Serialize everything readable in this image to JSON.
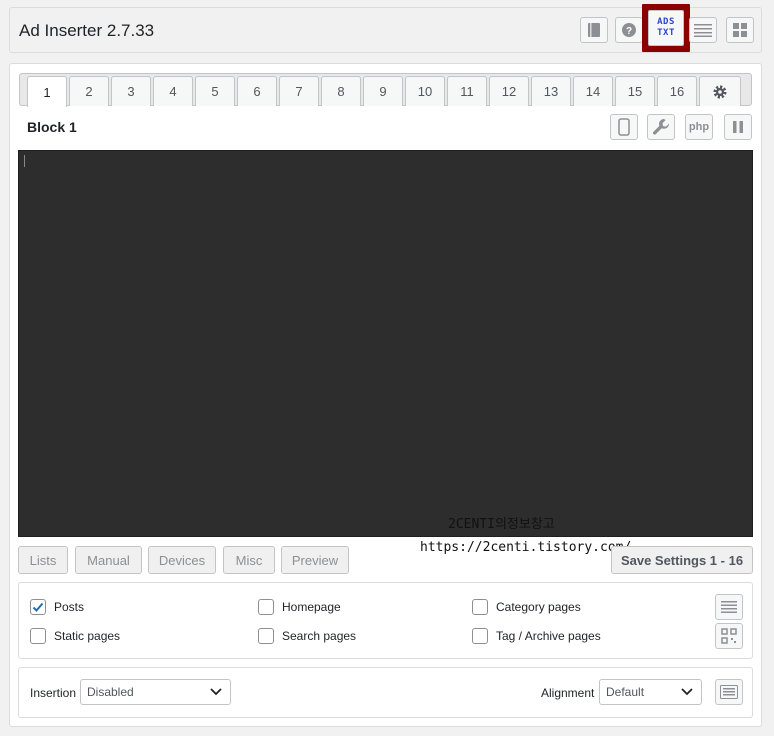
{
  "app": {
    "title": "Ad Inserter 2.7.33"
  },
  "header_icons": [
    "book-icon",
    "help-icon",
    "ads-txt-icon",
    "list-icon",
    "grid-icon"
  ],
  "ads_txt": {
    "line1": "ADS",
    "line2": "TXT"
  },
  "tabs": [
    "1",
    "2",
    "3",
    "4",
    "5",
    "6",
    "7",
    "8",
    "9",
    "10",
    "11",
    "12",
    "13",
    "14",
    "15",
    "16"
  ],
  "active_tab": "1",
  "block": {
    "title": "Block 1",
    "php_label": "php"
  },
  "buttons": {
    "lists": "Lists",
    "manual": "Manual",
    "devices": "Devices",
    "misc": "Misc",
    "preview": "Preview",
    "save": "Save Settings 1 - 16"
  },
  "watermark": {
    "line1": "2CENTI의정보창고",
    "line2": "https://2centi.tistory.com/"
  },
  "checkboxes": {
    "posts": {
      "label": "Posts",
      "checked": true
    },
    "homepage": {
      "label": "Homepage",
      "checked": false
    },
    "category": {
      "label": "Category pages",
      "checked": false
    },
    "static": {
      "label": "Static pages",
      "checked": false
    },
    "search": {
      "label": "Search pages",
      "checked": false
    },
    "tag": {
      "label": "Tag / Archive pages",
      "checked": false
    }
  },
  "insertion": {
    "label": "Insertion",
    "value": "Disabled"
  },
  "alignment": {
    "label": "Alignment",
    "value": "Default"
  },
  "colors": {
    "accent_red": "#8b0000",
    "editor_bg": "#2d2d2d",
    "ads_blue": "#2c44c8"
  }
}
